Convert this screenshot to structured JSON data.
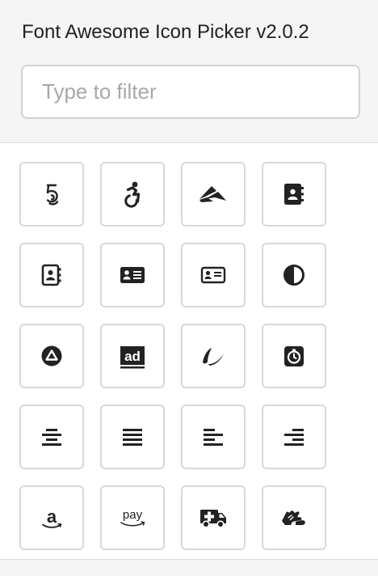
{
  "picker": {
    "title": "Font Awesome Icon Picker v2.0.2",
    "filter": {
      "placeholder": "Type to filter",
      "value": ""
    }
  },
  "icons": [
    "500px-icon",
    "accessible-icon",
    "accusoft-icon",
    "address-book-solid-icon",
    "address-book-regular-icon",
    "address-card-solid-icon",
    "address-card-regular-icon",
    "adjust-icon",
    "adn-icon",
    "adversal-icon",
    "affiliatetheme-icon",
    "alarm-clock-icon",
    "align-center-icon",
    "align-justify-icon",
    "align-left-icon",
    "align-right-icon",
    "amazon-icon",
    "amazon-pay-icon",
    "ambulance-icon",
    "american-sign-language-icon"
  ],
  "icon_labels": {
    "adversal": "ad",
    "amazon": "a",
    "amazon_pay": "pay"
  },
  "colors": {
    "header_bg": "#f5f5f5",
    "border": "#d8d8d8",
    "icon": "#222222",
    "placeholder": "#a8a8a8"
  }
}
